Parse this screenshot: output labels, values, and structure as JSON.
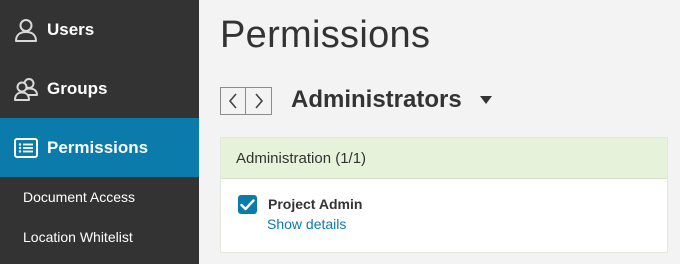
{
  "sidebar": {
    "items": [
      {
        "label": "Users",
        "icon": "user-icon",
        "active": false
      },
      {
        "label": "Groups",
        "icon": "groups-icon",
        "active": false
      },
      {
        "label": "Permissions",
        "icon": "list-icon",
        "active": true
      }
    ],
    "subitems": [
      {
        "label": "Document Access"
      },
      {
        "label": "Location Whitelist"
      }
    ]
  },
  "main": {
    "title": "Permissions",
    "group_selector": {
      "value": "Administrators",
      "icon": "caret-down-icon"
    },
    "pager": {
      "prev_icon": "chevron-left-icon",
      "next_icon": "chevron-right-icon"
    },
    "panel": {
      "header": "Administration (1/1)",
      "permissions": [
        {
          "label": "Project Admin",
          "checked": true,
          "link": "Show details"
        }
      ]
    }
  },
  "colors": {
    "sidebar_bg": "#333333",
    "active_bg": "#0b7bab",
    "panel_header_bg": "#e7f2da",
    "link": "#0b7bab"
  }
}
